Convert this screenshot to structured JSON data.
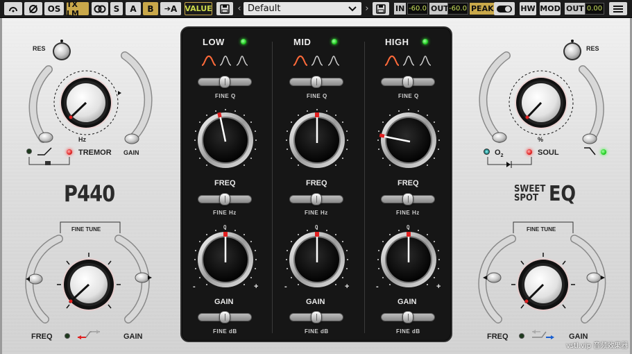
{
  "toolbar": {
    "undo_icon": "undo-icon",
    "phase_icon": "phase-icon",
    "os_label": "OS",
    "tx_label": "TX LM",
    "link_icon": "stereo-link-icon",
    "s_label": "S",
    "a_label": "A",
    "b_label": "B",
    "copy_label": "A",
    "value_label": "VALUE",
    "preset_name": "Default",
    "in_label": "IN",
    "in_value": "-60.0",
    "out_label": "OUT",
    "out_value": "-60.0",
    "peak_label": "PEAK",
    "hw_label": "HW",
    "mod_label": "MOD",
    "out2_label": "OUT",
    "out2_value": "0.00"
  },
  "left": {
    "res_label": "RES",
    "hz_label": "Hz",
    "tremor_label": "TREMOR",
    "gain_label": "GAIN",
    "title": "P440",
    "fine_tune_label": "FINE TUNE",
    "freq_label": "FREQ",
    "gain2_label": "GAIN"
  },
  "right": {
    "res_label": "RES",
    "percent_label": "%",
    "o2_label": "O",
    "o2_sub": "2",
    "soul_label": "SOUL",
    "brand_line1": "SWEET",
    "brand_line2": "SPOT",
    "brand_eq": "EQ",
    "fine_tune_label": "FINE TUNE",
    "freq_label": "FREQ",
    "gain_label": "GAIN"
  },
  "bands": [
    {
      "name": "LOW",
      "fine_q": "FINE Q",
      "freq": "FREQ",
      "fine_hz": "FINE Hz",
      "gain": "GAIN",
      "fine_db": "FINE dB",
      "zero": "0",
      "minus": "-",
      "plus": "+"
    },
    {
      "name": "MID",
      "fine_q": "FINE Q",
      "freq": "FREQ",
      "fine_hz": "FINE Hz",
      "gain": "GAIN",
      "fine_db": "FINE dB",
      "zero": "0",
      "minus": "-",
      "plus": "+"
    },
    {
      "name": "HIGH",
      "fine_q": "FINE Q",
      "freq": "FREQ",
      "fine_hz": "FINE Hz",
      "gain": "GAIN",
      "fine_db": "FINE dB",
      "zero": "0",
      "minus": "-",
      "plus": "+"
    }
  ],
  "watermark": "vstl.vip 音频效果器",
  "colors": {
    "accent_red": "#e02020",
    "led_green": "#22d022",
    "panel_dark": "#161616"
  }
}
